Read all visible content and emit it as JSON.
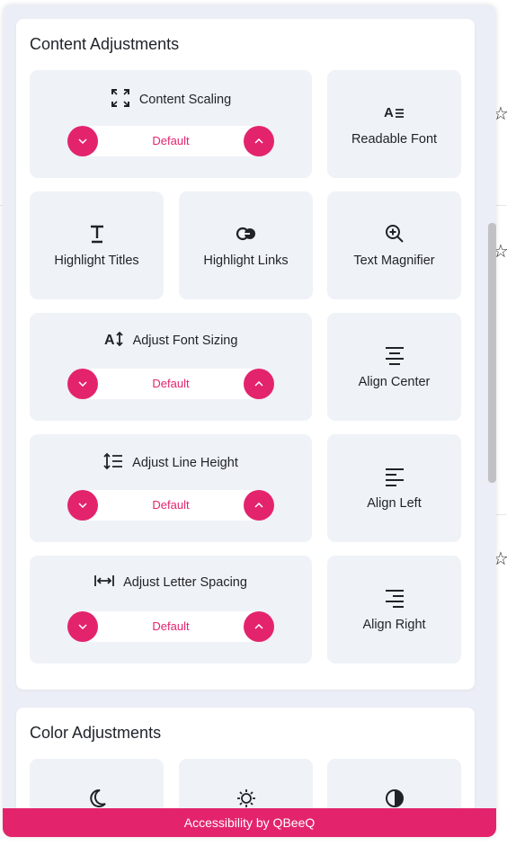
{
  "content_adjustments": {
    "title": "Content Adjustments",
    "content_scaling": {
      "label": "Content Scaling",
      "value": "Default",
      "icon": "expand-icon"
    },
    "readable_font": {
      "label": "Readable Font",
      "icon": "readable-font-icon"
    },
    "highlight_titles": {
      "label": "Highlight Titles",
      "icon": "title-icon"
    },
    "highlight_links": {
      "label": "Highlight Links",
      "icon": "link-icon"
    },
    "text_magnifier": {
      "label": "Text Magnifier",
      "icon": "magnifier-icon"
    },
    "font_sizing": {
      "label": "Adjust Font Sizing",
      "value": "Default",
      "icon": "font-size-icon"
    },
    "align_center": {
      "label": "Align Center",
      "icon": "align-center-icon"
    },
    "line_height": {
      "label": "Adjust Line Height",
      "value": "Default",
      "icon": "line-height-icon"
    },
    "align_left": {
      "label": "Align Left",
      "icon": "align-left-icon"
    },
    "letter_spacing": {
      "label": "Adjust Letter Spacing",
      "value": "Default",
      "icon": "letter-spacing-icon"
    },
    "align_right": {
      "label": "Align Right",
      "icon": "align-right-icon"
    }
  },
  "color_adjustments": {
    "title": "Color Adjustments",
    "tiles": [
      {
        "icon": "moon-icon"
      },
      {
        "icon": "sun-icon"
      },
      {
        "icon": "contrast-icon"
      }
    ]
  },
  "footer": {
    "label": "Accessibility by QBeeQ"
  },
  "colors": {
    "accent": "#e3246d",
    "tile_bg": "#eff2f7",
    "panel_bg": "#eceef7"
  }
}
